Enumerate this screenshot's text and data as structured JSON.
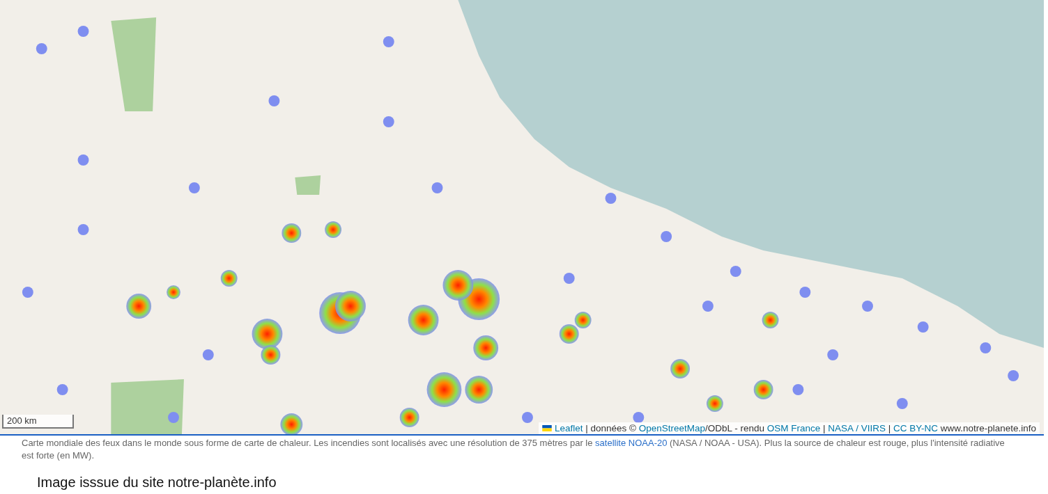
{
  "map": {
    "scale": "200 km",
    "attribution": [
      {
        "kind": "link",
        "text": "Leaflet"
      },
      {
        "kind": "text",
        "text": " | données © "
      },
      {
        "kind": "link",
        "text": "OpenStreetMap"
      },
      {
        "kind": "text",
        "text": "/ODbL - rendu "
      },
      {
        "kind": "link",
        "text": "OSM France"
      },
      {
        "kind": "text",
        "text": " | "
      },
      {
        "kind": "link",
        "text": "NASA / VIIRS"
      },
      {
        "kind": "text",
        "text": " | "
      },
      {
        "kind": "link",
        "text": "CC BY-NC"
      },
      {
        "kind": "text",
        "text": " www.notre-planete.info"
      }
    ]
  },
  "caption": [
    {
      "kind": "text",
      "text": "Carte mondiale des feux dans le monde sous forme de carte de chaleur. Les incendies sont localisés avec une résolution de 375 mètres par le "
    },
    {
      "kind": "link",
      "text": "satellite NOAA-20"
    },
    {
      "kind": "text",
      "text": " (NASA / NOAA - USA). Plus la source de chaleur est rouge, plus l'intensité radiative est forte (en MW)."
    }
  ],
  "credit": "Image isssue du site notre-planète.info"
}
